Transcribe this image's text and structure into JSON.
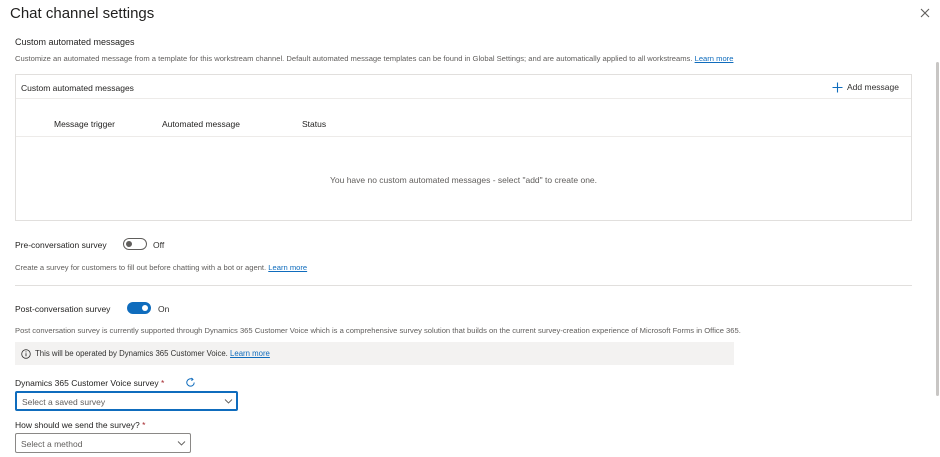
{
  "header": {
    "title": "Chat channel settings"
  },
  "automated": {
    "section_title": "Custom automated messages",
    "description": "Customize an automated message from a template for this workstream channel. Default automated message templates can be found in Global Settings; and are automatically applied to all workstreams.",
    "learn_more": "Learn more",
    "panel_title": "Custom automated messages",
    "add_label": "Add message",
    "columns": [
      "Message trigger",
      "Automated message",
      "Status"
    ],
    "empty_text": "You have no custom automated messages - select \"add\" to create one."
  },
  "pre_survey": {
    "label": "Pre-conversation survey",
    "state": "Off",
    "description": "Create a survey for customers to fill out before chatting with a bot or agent.",
    "learn_more": "Learn more"
  },
  "post_survey": {
    "label": "Post-conversation survey",
    "state": "On",
    "description": "Post conversation survey is currently supported through Dynamics 365 Customer Voice which is a comprehensive survey solution that builds on the current survey-creation experience of Microsoft Forms in Office 365.",
    "info_text": "This will be operated by Dynamics 365 Customer Voice.",
    "info_link": "Learn more",
    "survey_label": "Dynamics 365 Customer Voice survey",
    "survey_placeholder": "Select a saved survey",
    "method_label": "How should we send the survey?",
    "method_placeholder": "Select a method",
    "required_mark": "*"
  },
  "colors": {
    "accent": "#0f6cbd",
    "required": "#a4262c"
  },
  "icons": [
    "close-icon",
    "add-icon",
    "info-icon",
    "refresh-icon",
    "chevron-down-icon"
  ]
}
